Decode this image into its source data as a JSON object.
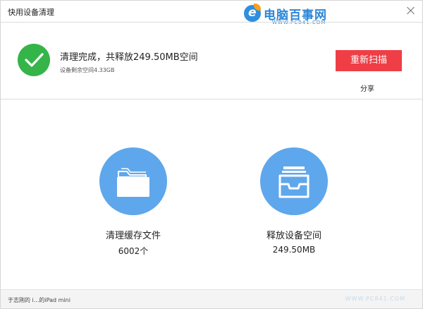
{
  "window": {
    "title": "快用设备清理"
  },
  "watermark": {
    "brand": "电脑百事网",
    "url": "WWW.PC841.COM",
    "footer_url": "WWW.PC841.COM"
  },
  "result": {
    "title": "清理完成，共释放249.50MB空间",
    "subtitle": "设备剩余空间4.33GB",
    "rescan_label": "重新扫描",
    "share_label": "分享"
  },
  "stats": [
    {
      "label": "清理缓存文件",
      "value": "6002个",
      "icon": "folder-icon"
    },
    {
      "label": "释放设备空间",
      "value": "249.50MB",
      "icon": "inbox-tray-icon"
    }
  ],
  "status": {
    "text": "于志刚的 i...的iPad mini"
  },
  "colors": {
    "success": "#35b449",
    "accent_button": "#ef3e46",
    "stat_circle": "#5fa7ec"
  }
}
